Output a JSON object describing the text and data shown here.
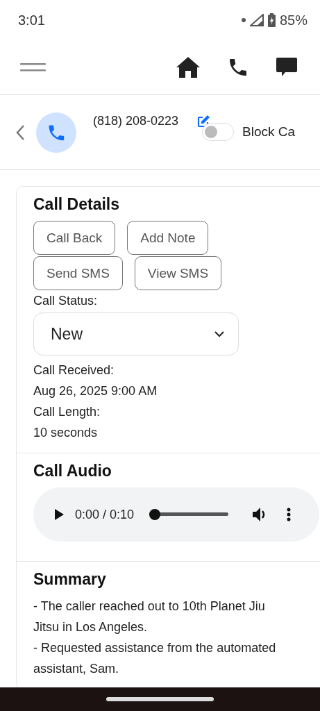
{
  "status_bar": {
    "time": "3:01",
    "battery": "85%"
  },
  "contact": {
    "phone": "(818) 208-0223",
    "block_toggle": {
      "label": "Block Ca",
      "on": false
    }
  },
  "call_details": {
    "title": "Call Details",
    "buttons": [
      "Call Back",
      "Add Note",
      "Send SMS",
      "View SMS"
    ],
    "status_label": "Call Status:",
    "status_value": "New",
    "fields": [
      {
        "label": "Call Received:",
        "value": "Aug 26, 2025 9:00 AM"
      },
      {
        "label": "Call Length:",
        "value": "10 seconds"
      }
    ]
  },
  "call_audio": {
    "title": "Call Audio",
    "time": "0:00 / 0:10",
    "level": 0
  },
  "summary": {
    "title": "Summary",
    "lines": [
      "- The caller reached out to 10th Planet Jiu",
      "Jitsu in Los Angeles.",
      "- Requested assistance from the automated",
      "assistant, Sam."
    ]
  }
}
